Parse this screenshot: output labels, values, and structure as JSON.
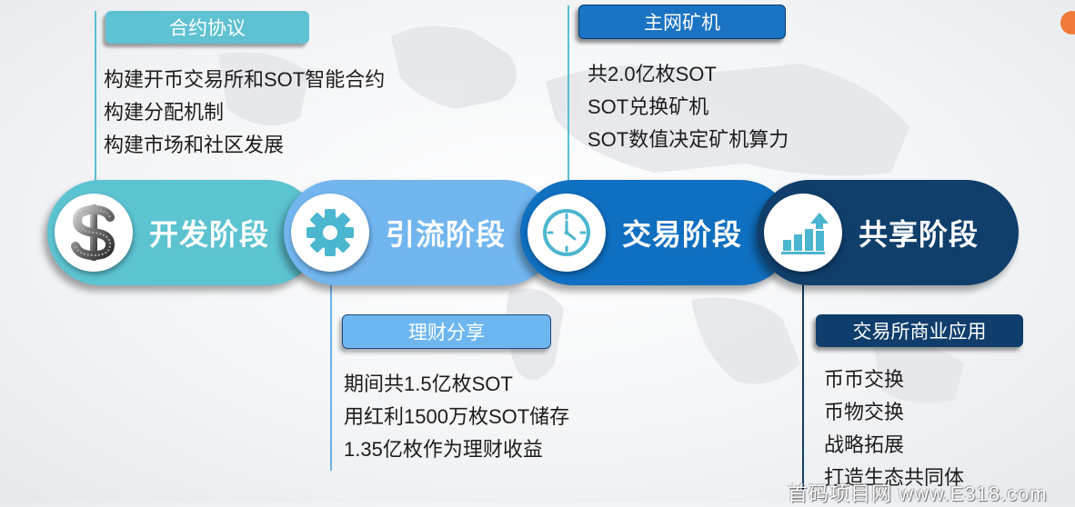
{
  "top_left_box": {
    "title": "合约协议",
    "items": [
      "构建开币交易所和SOT智能合约",
      "构建分配机制",
      "构建市场和社区发展"
    ]
  },
  "top_right_box": {
    "title": "主网矿机",
    "items": [
      "共2.0亿枚SOT",
      "SOT兑换矿机",
      "SOT数值决定矿机算力"
    ]
  },
  "bottom_left_box": {
    "title": "理财分享",
    "items": [
      "期间共1.5亿枚SOT",
      "用红利1500万枚SOT储存",
      "1.35亿枚作为理财收益"
    ]
  },
  "bottom_right_box": {
    "title": "交易所商业应用",
    "items": [
      "币币交换",
      "币物交换",
      "战略拓展",
      "打造生态共同体"
    ]
  },
  "stages": [
    {
      "label": "开发阶段",
      "icon": "dollar-icon",
      "color": "#5cc3d1"
    },
    {
      "label": "引流阶段",
      "icon": "gear-icon",
      "color": "#72b6f0"
    },
    {
      "label": "交易阶段",
      "icon": "clock-icon",
      "color": "#0f6fc0"
    },
    {
      "label": "共享阶段",
      "icon": "growth-chart-icon",
      "color": "#103f6c"
    }
  ],
  "watermark": "首码项目网 www.E318.com"
}
